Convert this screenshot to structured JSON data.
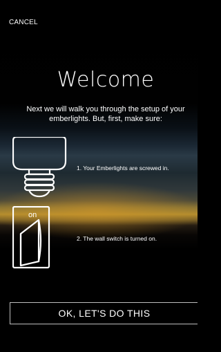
{
  "header": {
    "cancel_label": "CANCEL"
  },
  "main": {
    "title": "Welcome",
    "intro": "Next  we will walk you through the setup of your emberlights. But, first, make sure:",
    "items": [
      {
        "icon": "light-bulb-icon",
        "text": "1. Your Emberlights are screwed in."
      },
      {
        "icon": "wall-switch-icon",
        "switch_label": "on",
        "text": "2. The wall switch is turned on."
      }
    ]
  },
  "footer": {
    "confirm_label": "OK, LET'S DO THIS"
  },
  "colors": {
    "background": "#000000",
    "text": "#ffffff",
    "button_border": "#bfbfbf",
    "horizon_glow": "#b48d2e"
  }
}
